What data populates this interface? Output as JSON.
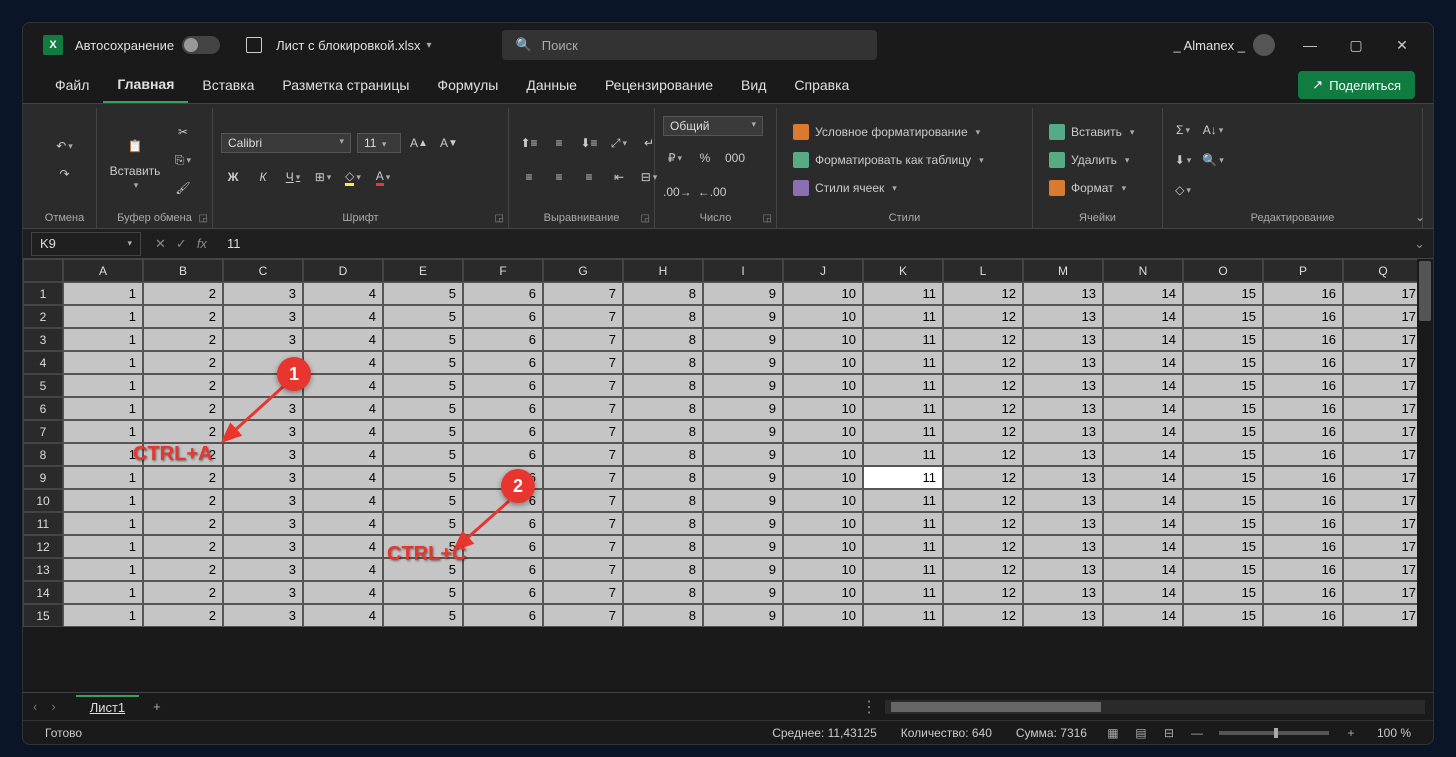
{
  "titlebar": {
    "autosave_label": "Автосохранение",
    "filename": "Лист с блокировкой.xlsx",
    "search_placeholder": "Поиск",
    "username": "_ Almanex _"
  },
  "tabs": {
    "items": [
      "Файл",
      "Главная",
      "Вставка",
      "Разметка страницы",
      "Формулы",
      "Данные",
      "Рецензирование",
      "Вид",
      "Справка"
    ],
    "active_index": 1,
    "share": "Поделиться"
  },
  "ribbon": {
    "undo_label": "Отмена",
    "clipboard": {
      "paste": "Вставить",
      "group": "Буфер обмена"
    },
    "font": {
      "name": "Calibri",
      "size": "11",
      "bold": "Ж",
      "italic": "К",
      "underline": "Ч",
      "group": "Шрифт"
    },
    "align": {
      "group": "Выравнивание"
    },
    "number": {
      "format": "Общий",
      "group": "Число"
    },
    "styles": {
      "cond": "Условное форматирование",
      "table": "Форматировать как таблицу",
      "cell": "Стили ячеек",
      "group": "Стили"
    },
    "cells": {
      "insert": "Вставить",
      "delete": "Удалить",
      "format": "Формат",
      "group": "Ячейки"
    },
    "editing": {
      "group": "Редактирование"
    }
  },
  "formula_bar": {
    "cell_ref": "K9",
    "formula": "11"
  },
  "grid": {
    "columns": [
      "A",
      "B",
      "C",
      "D",
      "E",
      "F",
      "G",
      "H",
      "I",
      "J",
      "K",
      "L",
      "M",
      "N",
      "O",
      "P",
      "Q"
    ],
    "row_count": 15,
    "row_values": [
      1,
      2,
      3,
      4,
      5,
      6,
      7,
      8,
      9,
      10,
      11,
      12,
      13,
      14,
      15,
      16,
      17
    ],
    "active_row": 9,
    "active_col": 11
  },
  "annotations": {
    "b1": "1",
    "t1": "CTRL+A",
    "b2": "2",
    "t2": "CTRL+C"
  },
  "sheetbar": {
    "sheet": "Лист1"
  },
  "status": {
    "ready": "Готово",
    "avg": "Среднее: 11,43125",
    "count": "Количество: 640",
    "sum": "Сумма: 7316",
    "zoom": "100 %"
  }
}
